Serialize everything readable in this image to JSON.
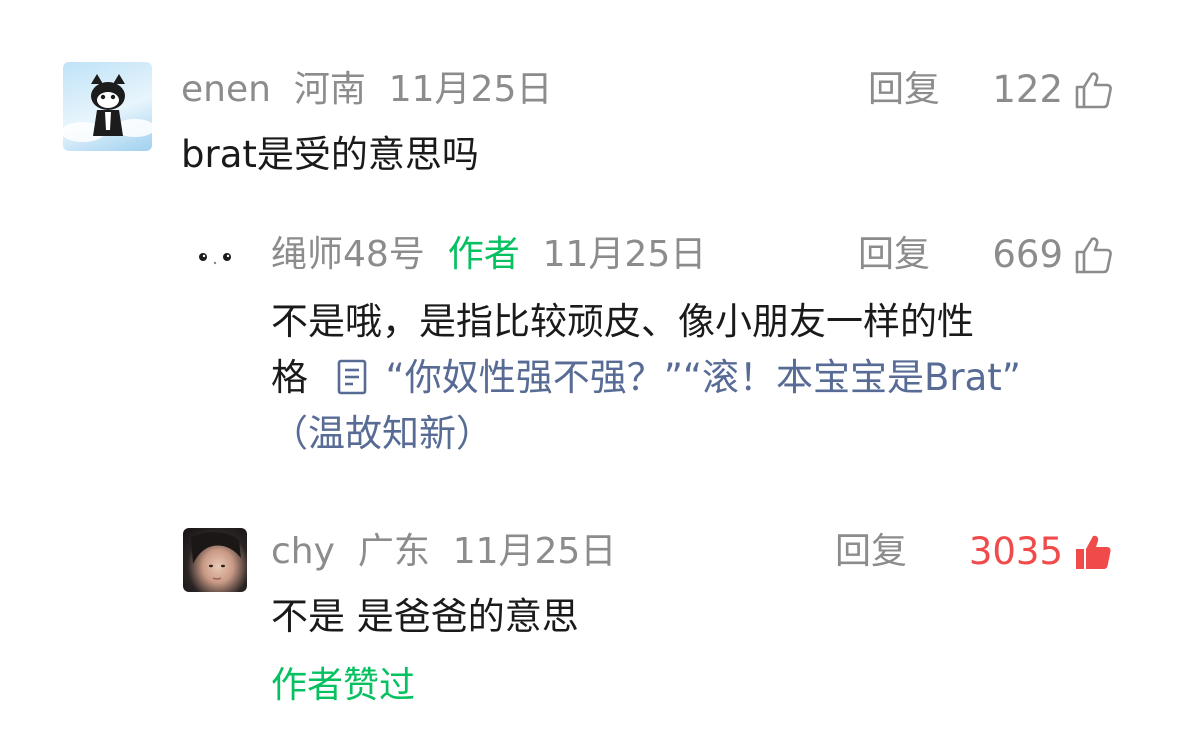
{
  "colors": {
    "meta_gray": "#8c8c8c",
    "author_green": "#07c160",
    "link_blue": "#576b95",
    "liked_red": "#f04a4a",
    "text_dark": "#1a1a1a"
  },
  "comments": [
    {
      "username": "enen",
      "location": "河南",
      "date": "11月25日",
      "reply_label": "回复",
      "likes": "122",
      "liked": false,
      "text": "brat是受的意思吗",
      "avatar_icon": "cartoon-cat-icon"
    },
    {
      "username": "绳师48号",
      "author_tag": "作者",
      "date": "11月25日",
      "reply_label": "回复",
      "likes": "669",
      "liked": false,
      "text_line1": "不是哦，是指比较顽皮、像小朋友一样的性",
      "text_line2_prefix": "格",
      "link_icon": "document-icon",
      "link_line1": "“你奴性强不强？”“滚！本宝宝是Brat”",
      "link_line2": "（温故知新）",
      "avatar_icon": "dots-face-icon"
    },
    {
      "username": "chy",
      "location": "广东",
      "date": "11月25日",
      "reply_label": "回复",
      "likes": "3035",
      "liked": true,
      "text": "不是 是爸爸的意思",
      "author_liked_label": "作者赞过",
      "avatar_icon": "user-photo-icon"
    }
  ]
}
